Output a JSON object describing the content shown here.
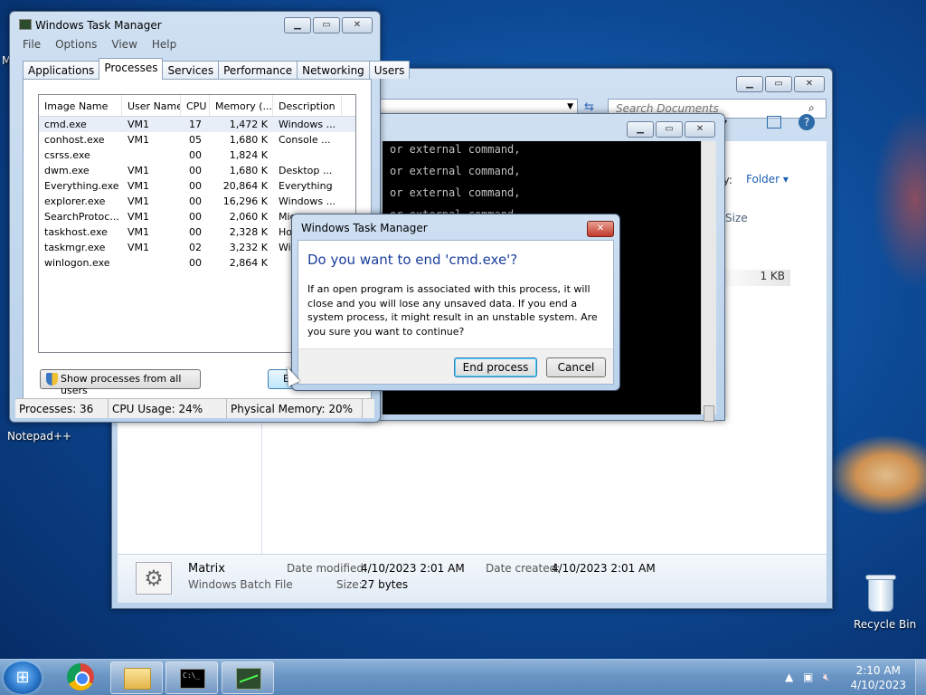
{
  "desktop": {
    "left_icon_label": "Notepad++",
    "left_icon_label_partial": "M",
    "recycle_bin_label": "Recycle Bin"
  },
  "explorer": {
    "search_placeholder": "Search Documents",
    "arrange_label": "by:",
    "arrange_value": "Folder",
    "col_size": "Size",
    "file_size": "1 KB",
    "details": {
      "name": "Matrix",
      "type": "Windows Batch File",
      "modified_label": "Date modified:",
      "modified_value": "4/10/2023 2:01 AM",
      "created_label": "Date created:",
      "created_value": "4/10/2023 2:01 AM",
      "size_label": "Size:",
      "size_value": "27 bytes"
    }
  },
  "cmd": {
    "lines": [
      "or external command,",
      "or external command,",
      "or external command,",
      "or external command,"
    ]
  },
  "taskmgr": {
    "title": "Windows Task Manager",
    "menu": [
      "File",
      "Options",
      "View",
      "Help"
    ],
    "tabs": [
      "Applications",
      "Processes",
      "Services",
      "Performance",
      "Networking",
      "Users"
    ],
    "active_tab": "Processes",
    "columns": [
      "Image Name",
      "User Name",
      "CPU",
      "Memory (...",
      "Description"
    ],
    "processes": [
      {
        "name": "cmd.exe",
        "user": "VM1",
        "cpu": "17",
        "mem": "1,472 K",
        "desc": "Windows ..."
      },
      {
        "name": "conhost.exe",
        "user": "VM1",
        "cpu": "05",
        "mem": "1,680 K",
        "desc": "Console ..."
      },
      {
        "name": "csrss.exe",
        "user": "",
        "cpu": "00",
        "mem": "1,824 K",
        "desc": ""
      },
      {
        "name": "dwm.exe",
        "user": "VM1",
        "cpu": "00",
        "mem": "1,680 K",
        "desc": "Desktop ..."
      },
      {
        "name": "Everything.exe",
        "user": "VM1",
        "cpu": "00",
        "mem": "20,864 K",
        "desc": "Everything"
      },
      {
        "name": "explorer.exe",
        "user": "VM1",
        "cpu": "00",
        "mem": "16,296 K",
        "desc": "Windows ..."
      },
      {
        "name": "SearchProtoc...",
        "user": "VM1",
        "cpu": "00",
        "mem": "2,060 K",
        "desc": "Micr"
      },
      {
        "name": "taskhost.exe",
        "user": "VM1",
        "cpu": "00",
        "mem": "2,328 K",
        "desc": "Hos"
      },
      {
        "name": "taskmgr.exe",
        "user": "VM1",
        "cpu": "02",
        "mem": "3,232 K",
        "desc": "Win"
      },
      {
        "name": "winlogon.exe",
        "user": "",
        "cpu": "00",
        "mem": "2,864 K",
        "desc": ""
      }
    ],
    "show_all_label": "Show processes from all users",
    "end_partial": "E",
    "status": {
      "processes": "Processes: 36",
      "cpu": "CPU Usage: 24%",
      "memory": "Physical Memory: 20%"
    }
  },
  "dialog": {
    "title": "Windows Task Manager",
    "question": "Do you want to end 'cmd.exe'?",
    "message": "If an open program is associated with this process, it will close and you will lose any unsaved data. If you end a system process, it might result in an unstable system. Are you sure you want to continue?",
    "end_button": "End process",
    "cancel_button": "Cancel"
  },
  "taskbar": {
    "time": "2:10 AM",
    "date": "4/10/2023"
  }
}
